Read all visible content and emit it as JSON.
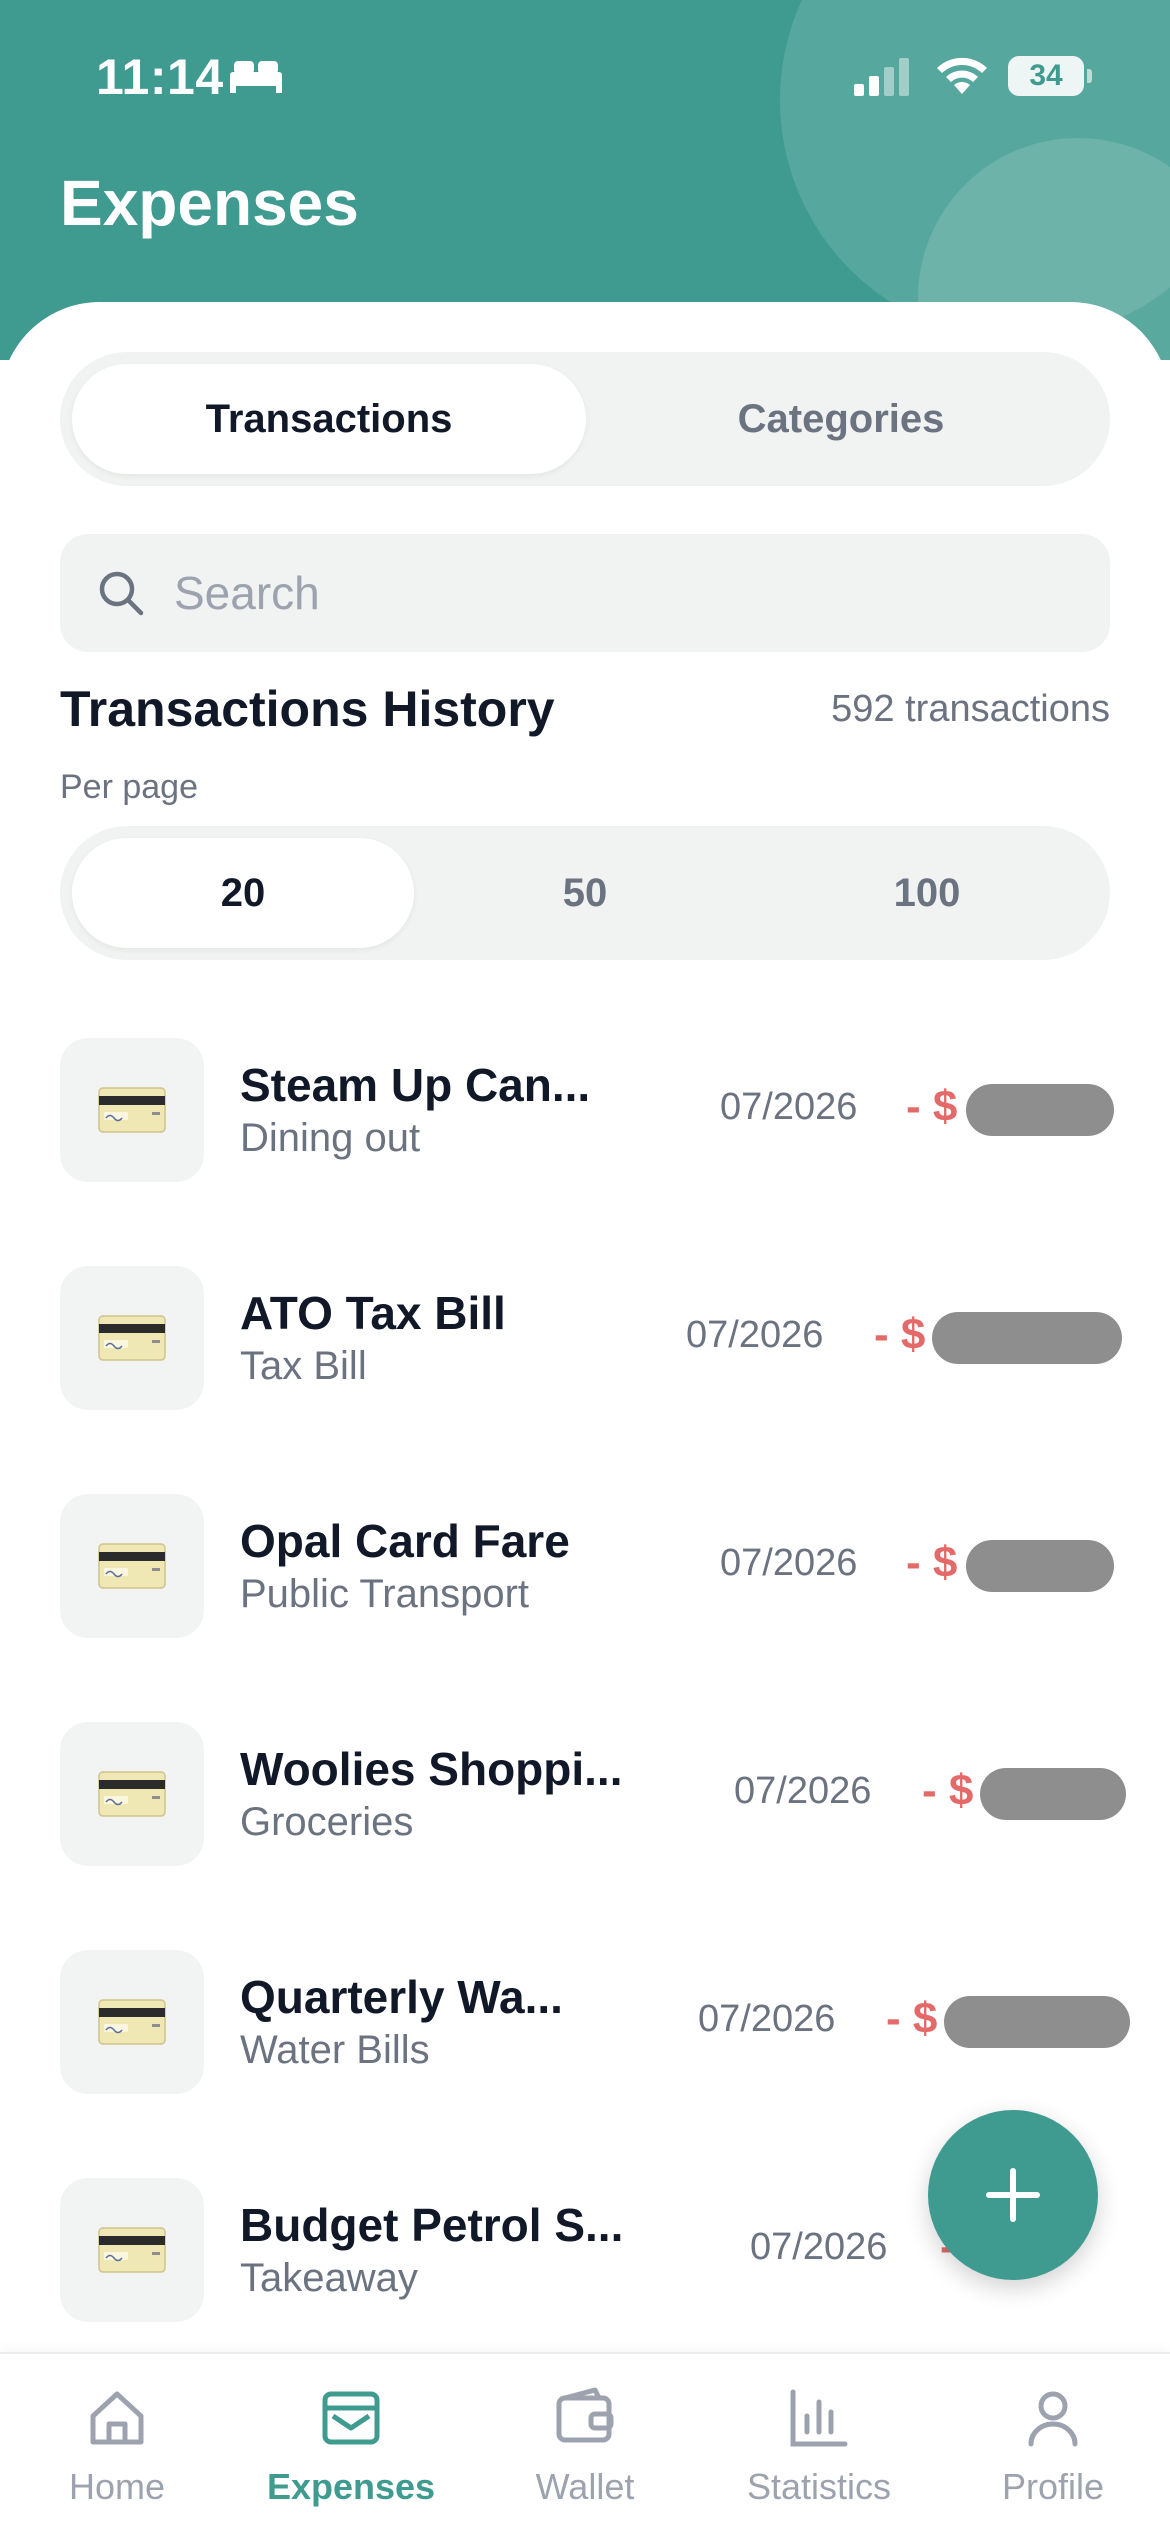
{
  "status_bar": {
    "time": "11:14",
    "battery": "34"
  },
  "header": {
    "title": "Expenses"
  },
  "tabs": [
    {
      "label": "Transactions",
      "active": true
    },
    {
      "label": "Categories",
      "active": false
    }
  ],
  "search": {
    "placeholder": "Search",
    "value": ""
  },
  "history": {
    "title": "Transactions History",
    "count": "592 transactions",
    "per_page_label": "Per page"
  },
  "per_page_options": [
    {
      "label": "20",
      "active": true
    },
    {
      "label": "50",
      "active": false
    },
    {
      "label": "100",
      "active": false
    }
  ],
  "transactions": [
    {
      "name": "Steam Up Can...",
      "category": "Dining out",
      "date": "07/2026",
      "amount": "- $",
      "icon": "credit-card-icon"
    },
    {
      "name": "ATO Tax Bill",
      "category": "Tax Bill",
      "date": "07/2026",
      "amount": "- $",
      "icon": "credit-card-icon"
    },
    {
      "name": "Opal Card Fare",
      "category": "Public Transport",
      "date": "07/2026",
      "amount": "- $",
      "icon": "credit-card-icon"
    },
    {
      "name": "Woolies Shoppi...",
      "category": "Groceries",
      "date": "07/2026",
      "amount": "- $",
      "icon": "credit-card-icon"
    },
    {
      "name": "Quarterly Wa...",
      "category": "Water Bills",
      "date": "07/2026",
      "amount": "- $",
      "icon": "credit-card-icon"
    },
    {
      "name": "Budget Petrol S...",
      "category": "Takeaway",
      "date": "07/2026",
      "amount": "- $.00",
      "icon": "credit-card-icon"
    }
  ],
  "fab": {
    "icon": "plus-icon"
  },
  "tabbar": [
    {
      "label": "Home",
      "icon": "home-icon",
      "active": false
    },
    {
      "label": "Expenses",
      "icon": "inbox-icon",
      "active": true
    },
    {
      "label": "Wallet",
      "icon": "wallet-icon",
      "active": false
    },
    {
      "label": "Statistics",
      "icon": "bar-chart-icon",
      "active": false
    },
    {
      "label": "Profile",
      "icon": "user-icon",
      "active": false
    }
  ],
  "colors": {
    "primary": "#3f9b90",
    "expense_red": "#e46a6a",
    "muted_text": "#6b7280",
    "surface": "#f1f3f2"
  }
}
